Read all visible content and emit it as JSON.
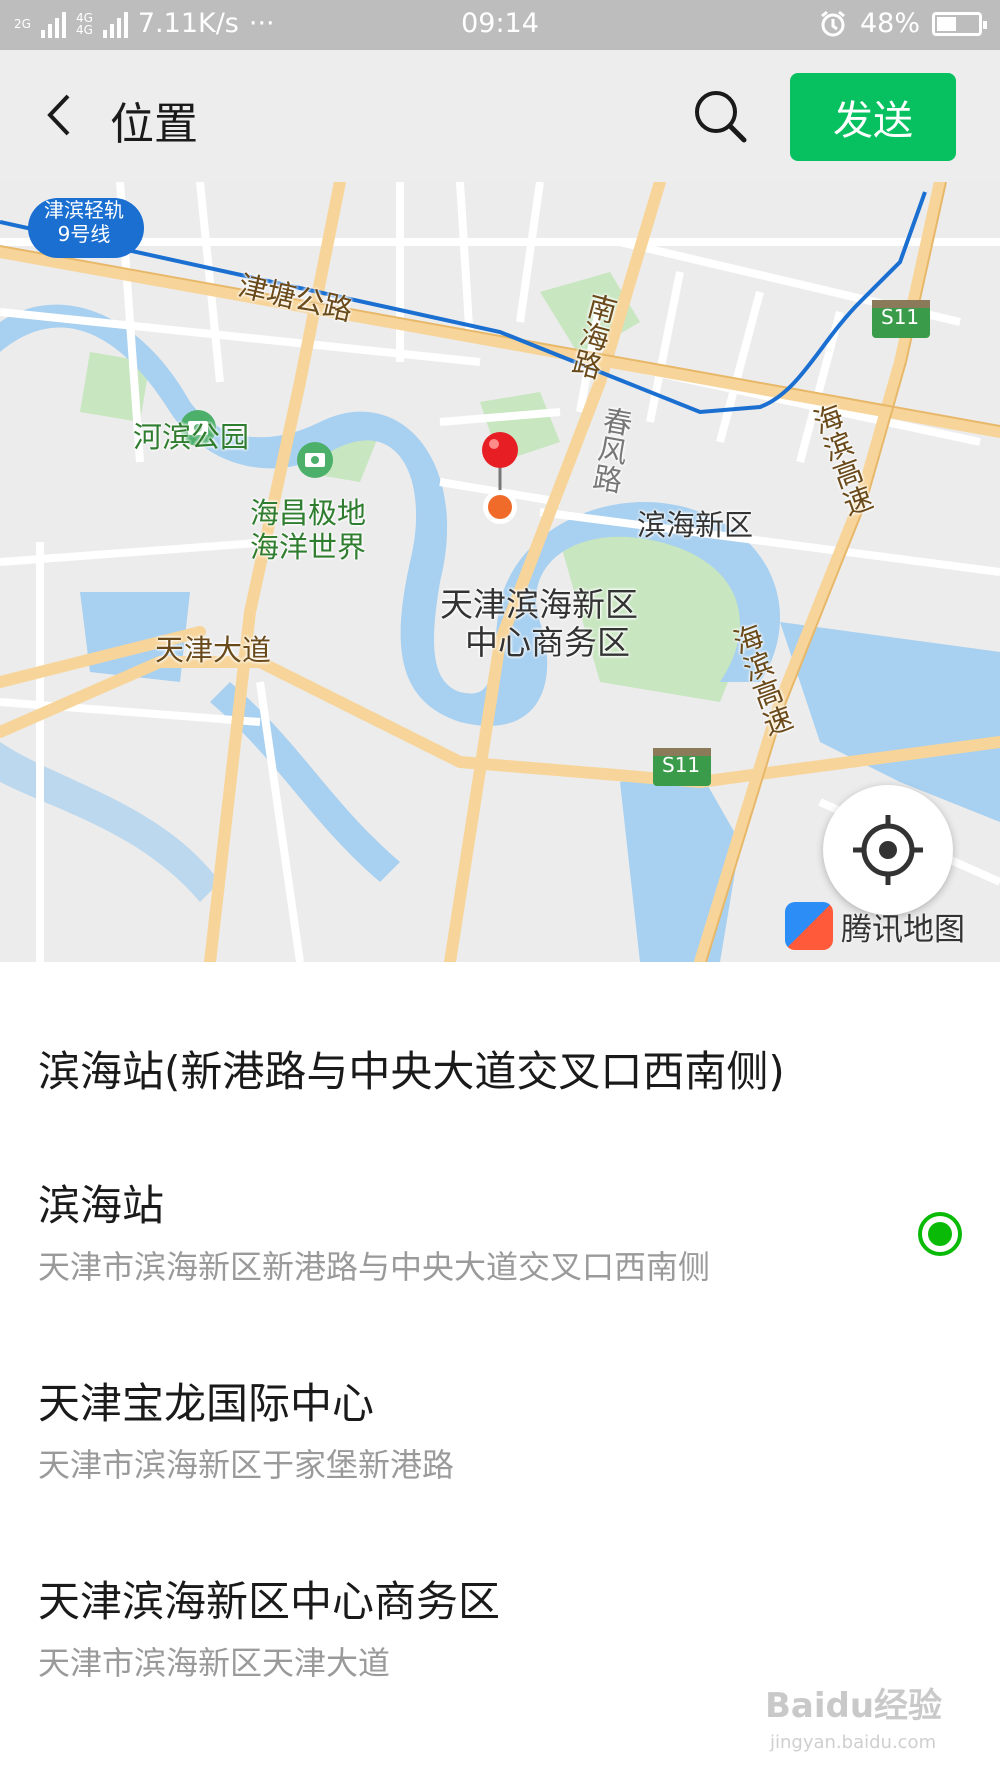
{
  "status_bar": {
    "network_1": "2G",
    "network_2": "4G",
    "network_3": "4G",
    "speed": "7.11K/s",
    "more": "···",
    "time": "09:14",
    "battery": "48%",
    "battery_level": 0.48
  },
  "header": {
    "title": "位置",
    "send_label": "发送",
    "back_icon": "chevron-left-icon",
    "search_icon": "search-icon"
  },
  "map": {
    "labels": {
      "metro_line": "津滨轻轨",
      "metro_line_2": "9号线",
      "jintang_road": "津塘公路",
      "nanhai_road": "南海路",
      "s11_top": "S11",
      "hebin_park": "河滨公园",
      "chunfeng_road": "春风路",
      "haibin_expressway": "海滨高速",
      "haibin_expressway_2": "海滨高速",
      "haichang_1": "海昌极地",
      "haichang_2": "海洋世界",
      "binhai_district": "滨海新区",
      "cbd_1": "天津滨海新区",
      "cbd_2": "中心商务区",
      "tianjin_avenue": "天津大道",
      "s11_bottom": "S11"
    },
    "brand": "腾讯地图",
    "locate_icon": "crosshair-icon",
    "pin_icon": "map-pin-icon",
    "colors": {
      "water": "#a8d0f0",
      "road": "#f7d59a",
      "metro": "#1a6fd1",
      "park": "#c8e6c0",
      "pin": "#e81e25"
    }
  },
  "results": [
    {
      "name": "滨海站(新港路与中央大道交叉口西南侧)",
      "address": "",
      "selected": false
    },
    {
      "name": "滨海站",
      "address": "天津市滨海新区新港路与中央大道交叉口西南侧",
      "selected": true
    },
    {
      "name": "天津宝龙国际中心",
      "address": "天津市滨海新区于家堡新港路",
      "selected": false
    },
    {
      "name": "天津滨海新区中心商务区",
      "address": "天津市滨海新区天津大道",
      "selected": false
    }
  ],
  "watermark": {
    "main": "Baidu经验",
    "sub": "jingyan.baidu.com"
  },
  "accent_color": "#07c160"
}
